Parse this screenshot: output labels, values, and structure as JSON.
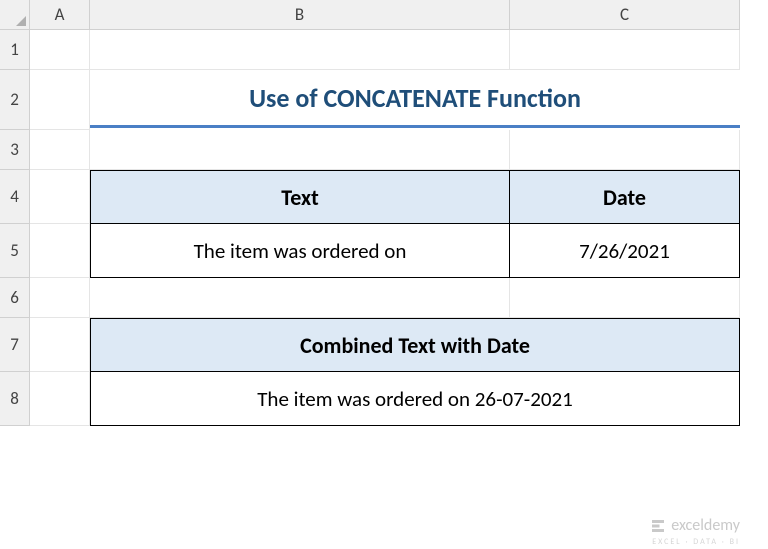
{
  "columns": [
    "A",
    "B",
    "C"
  ],
  "rows": [
    "1",
    "2",
    "3",
    "4",
    "5",
    "6",
    "7",
    "8"
  ],
  "title": "Use of CONCATENATE Function",
  "table1": {
    "header_text": "Text",
    "header_date": "Date",
    "value_text": "The item was ordered on",
    "value_date": "7/26/2021"
  },
  "table2": {
    "header": "Combined Text with Date",
    "value": "The item was ordered on 26-07-2021"
  },
  "watermark": {
    "name": "exceldemy",
    "tagline": "EXCEL · DATA · BI"
  },
  "chart_data": {
    "type": "table",
    "title": "Use of CONCATENATE Function",
    "tables": [
      {
        "headers": [
          "Text",
          "Date"
        ],
        "rows": [
          [
            "The item was ordered on",
            "7/26/2021"
          ]
        ]
      },
      {
        "headers": [
          "Combined Text with Date"
        ],
        "rows": [
          [
            "The item was ordered on 26-07-2021"
          ]
        ]
      }
    ]
  }
}
